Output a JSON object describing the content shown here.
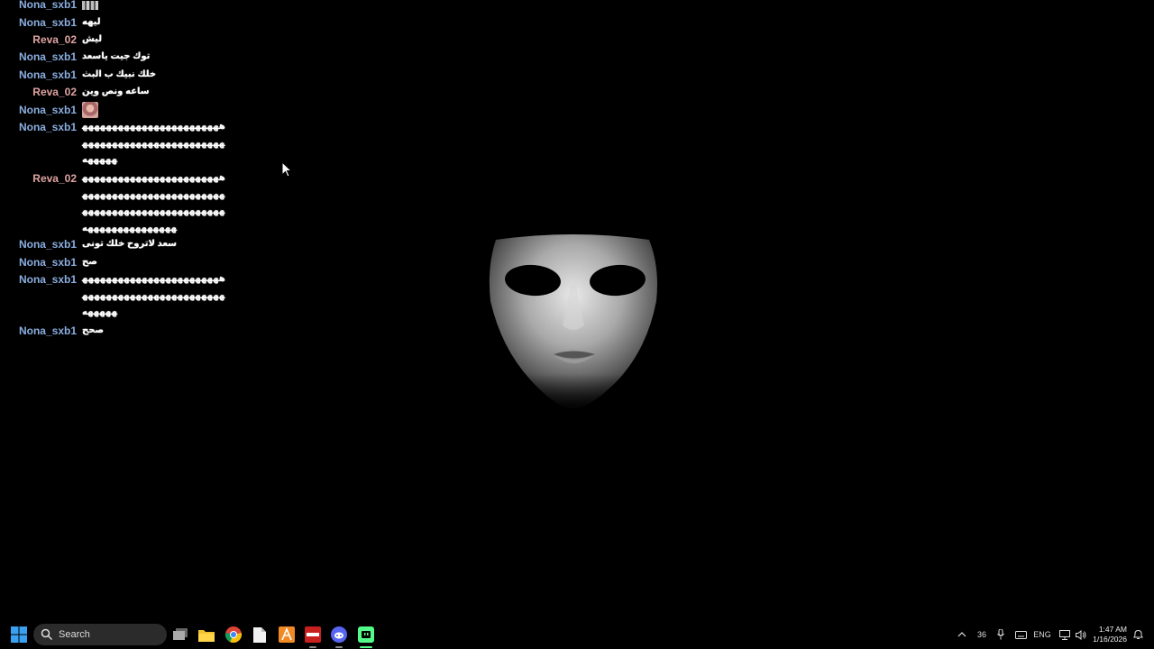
{
  "colors": {
    "nona": "#8aaee0",
    "reva": "#e0a3a3",
    "background": "#000000",
    "text": "#ffffff"
  },
  "chat": {
    "messages": [
      {
        "user": "Nona_sxb1",
        "text": "",
        "emote": "small-bars-emote"
      },
      {
        "user": "Nona_sxb1",
        "text": "ليهه"
      },
      {
        "user": "Reva_02",
        "text": "ليش"
      },
      {
        "user": "Nona_sxb1",
        "text": "توك جيت ياسعد"
      },
      {
        "user": "Nona_sxb1",
        "text": "خلك نبيك ب البث"
      },
      {
        "user": "Reva_02",
        "text": "ساعه ونص وين"
      },
      {
        "user": "Nona_sxb1",
        "text": "",
        "emote": "avatar-emote"
      },
      {
        "user": "Nona_sxb1",
        "text": "هههههههههههههههههههههههههههههههههههههههههههههههههههههه"
      },
      {
        "user": "Reva_02",
        "text": "هههههههههههههههههههههههههههههههههههههههههههههههههههههههههههههههههههههههههههههههههههههههه"
      },
      {
        "user": "Nona_sxb1",
        "text": "سعد لاتروح خلك تونى"
      },
      {
        "user": "Nona_sxb1",
        "text": "صح"
      },
      {
        "user": "Nona_sxb1",
        "text": "هههههههههههههههههههههههههههههههههههههههههههههههههههههه"
      },
      {
        "user": "Nona_sxb1",
        "text": "صحح"
      }
    ]
  },
  "taskbar": {
    "search_label": "Search",
    "apps": [
      "task-view-icon",
      "file-explorer-icon",
      "chrome-icon",
      "file-icon",
      "app-orange-icon",
      "video-app-icon",
      "discord-icon",
      "streaming-app-icon"
    ],
    "tray": {
      "badge": "36",
      "language": "ENG",
      "time": "1:47 AM",
      "date": "1/16/2026"
    }
  }
}
